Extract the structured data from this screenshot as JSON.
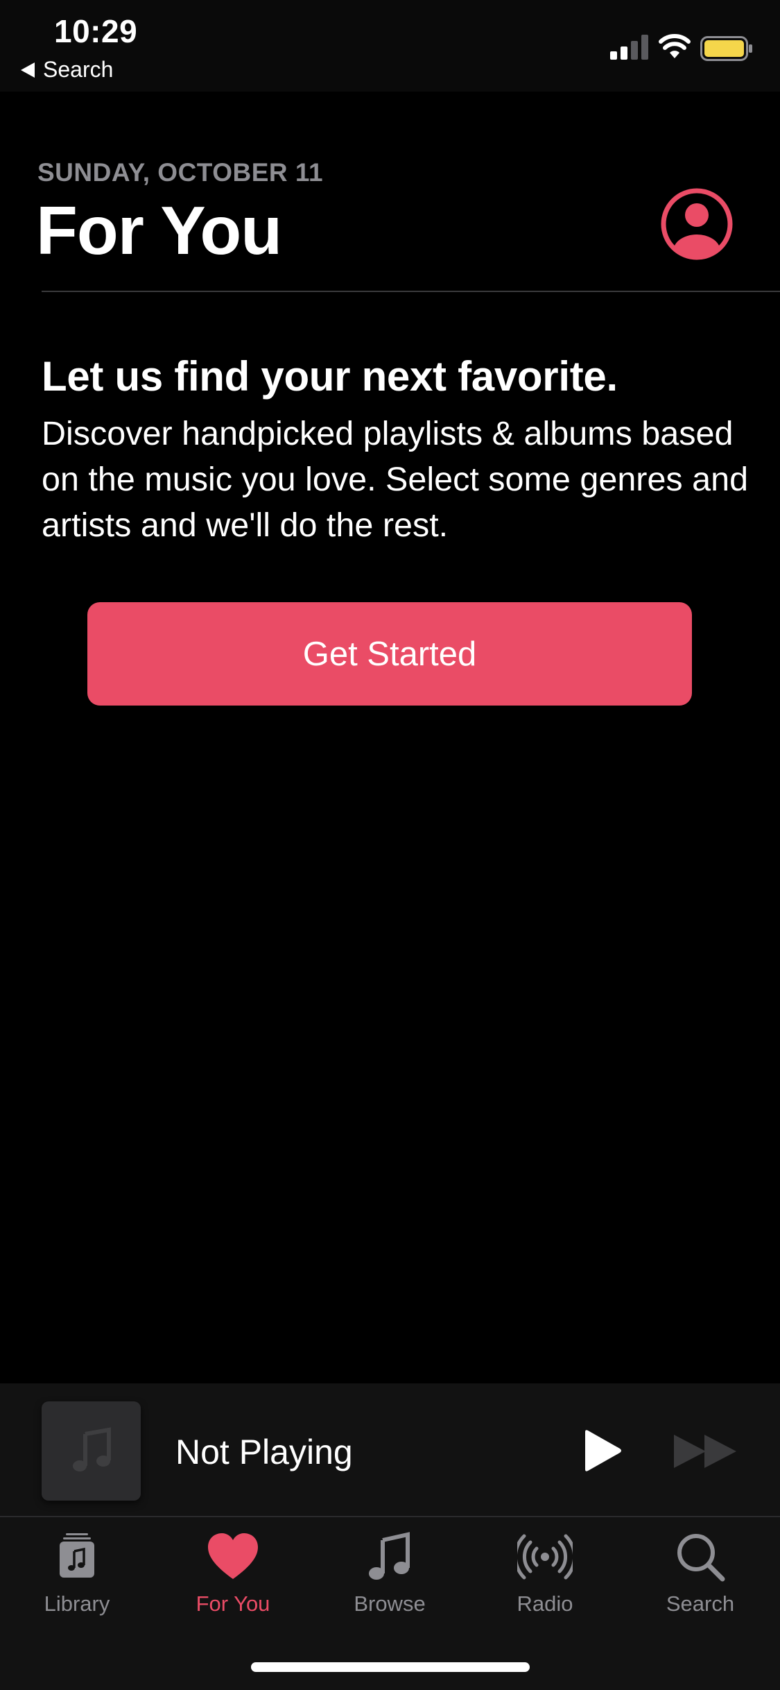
{
  "status_bar": {
    "time": "10:29",
    "back_label": "Search"
  },
  "header": {
    "date": "SUNDAY, OCTOBER 11",
    "title": "For You"
  },
  "main": {
    "headline": "Let us find your next favorite.",
    "body": "Discover handpicked playlists & albums based on the music you love. Select some genres and artists and we'll do the rest.",
    "cta_label": "Get Started"
  },
  "mini_player": {
    "label": "Not Playing"
  },
  "tab_bar": {
    "tabs": [
      {
        "label": "Library",
        "icon": "library-icon",
        "active": false
      },
      {
        "label": "For You",
        "icon": "heart-icon",
        "active": true
      },
      {
        "label": "Browse",
        "icon": "music-note-icon",
        "active": false
      },
      {
        "label": "Radio",
        "icon": "radio-broadcast-icon",
        "active": false
      },
      {
        "label": "Search",
        "icon": "search-icon",
        "active": false
      }
    ]
  },
  "colors": {
    "accent": "#ea4c66",
    "background": "#000000",
    "secondary_text": "#8e8e93",
    "battery": "#f5d64b"
  }
}
